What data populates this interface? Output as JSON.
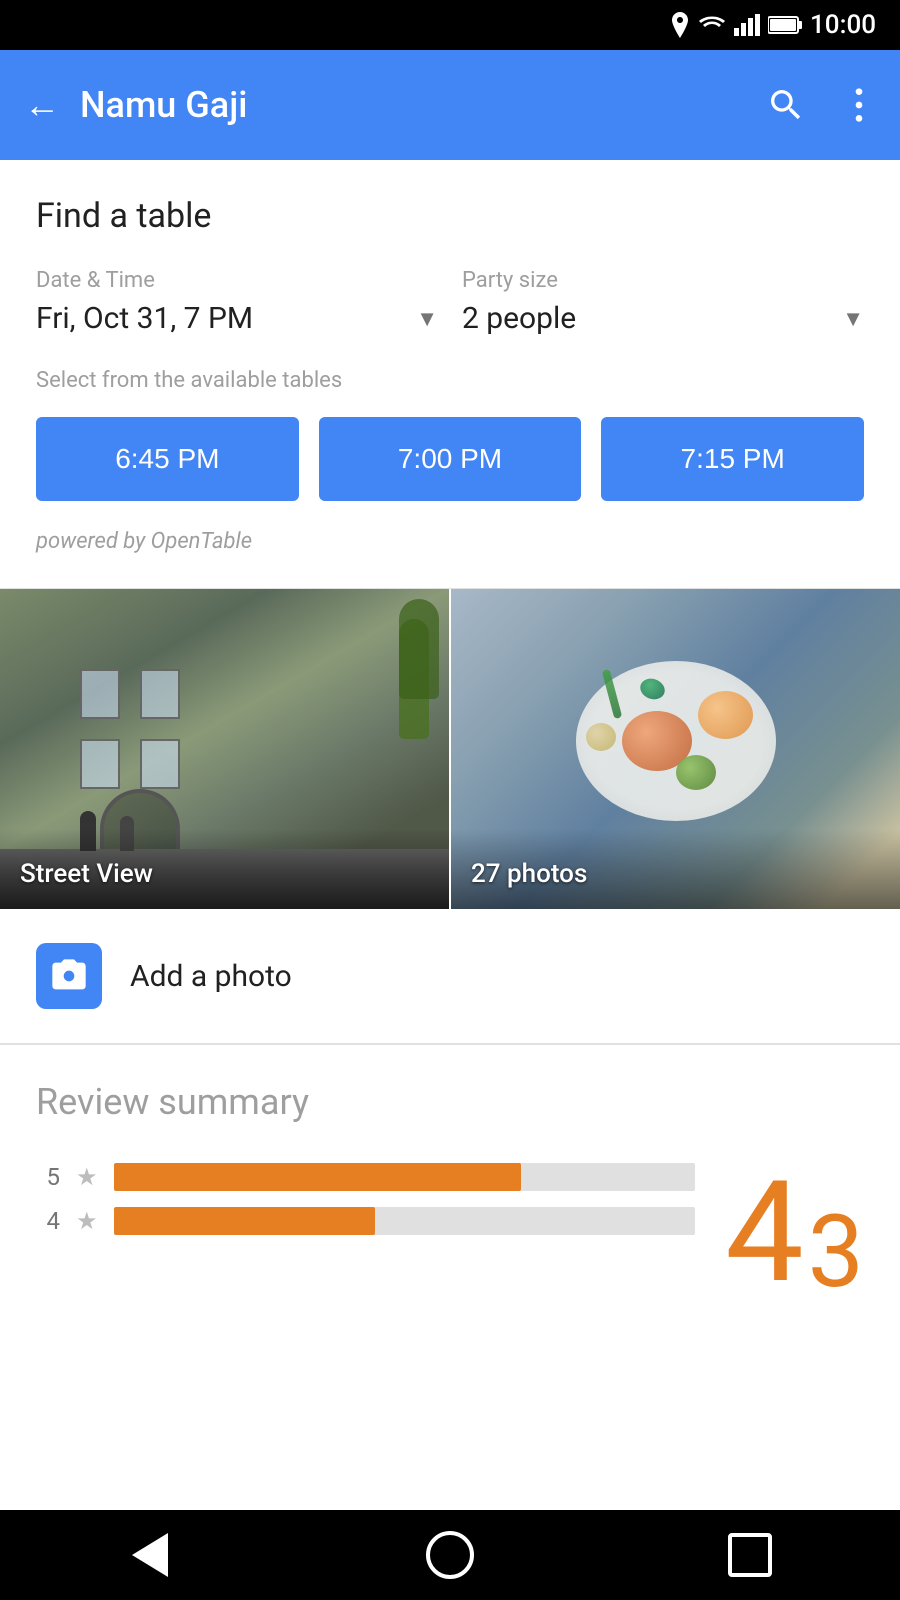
{
  "status_bar": {
    "time": "10:00",
    "icons": [
      "location-pin",
      "wifi",
      "signal",
      "battery"
    ]
  },
  "app_bar": {
    "title": "Namu Gaji",
    "back_label": "←",
    "search_label": "search",
    "more_label": "more"
  },
  "find_table": {
    "section_title": "Find a table",
    "date_time_label": "Date & Time",
    "date_time_value": "Fri, Oct 31, 7 PM",
    "party_size_label": "Party size",
    "party_size_value": "2 people",
    "available_tables_label": "Select from the available tables",
    "time_slots": [
      "6:45 PM",
      "7:00 PM",
      "7:15 PM"
    ],
    "powered_by": "powered by OpenTable"
  },
  "photo_gallery": {
    "street_view_label": "Street View",
    "photos_label": "27 photos"
  },
  "add_photo": {
    "label": "Add a photo"
  },
  "review_summary": {
    "title": "Review summary",
    "rating_value": "4",
    "rating_decimal": "3",
    "bars": [
      {
        "star": "5",
        "width_pct": 70
      },
      {
        "star": "4",
        "width_pct": 45
      }
    ]
  },
  "bottom_nav": {
    "back_label": "Back",
    "home_label": "Home",
    "recents_label": "Recents"
  }
}
